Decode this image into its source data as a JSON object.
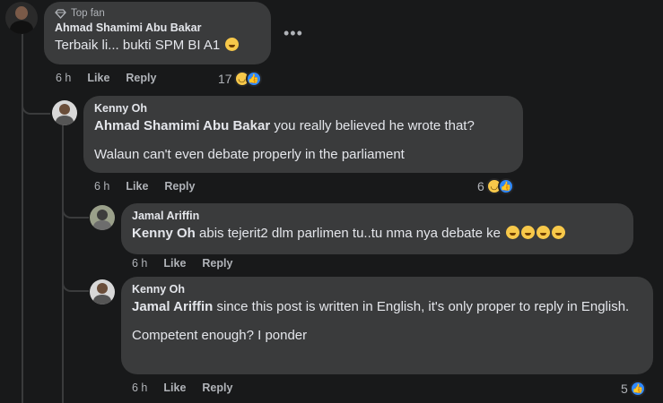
{
  "comments": [
    {
      "badge": "Top fan",
      "author": "Ahmad Shamimi Abu Bakar",
      "text": "Terbaik li... bukti SPM BI A1",
      "time": "6 h",
      "like": "Like",
      "reply": "Reply",
      "reactions": "17"
    },
    {
      "author": "Kenny Oh",
      "mention": "Ahmad Shamimi Abu Bakar",
      "text_after_mention": " you really believed he wrote that?",
      "text2": "Walaun can't even debate properly in the parliament",
      "time": "6 h",
      "like": "Like",
      "reply": "Reply",
      "reactions": "6"
    },
    {
      "author": "Jamal Ariffin",
      "mention": "Kenny Oh",
      "text_after_mention": " abis tejerit2 dlm parlimen tu..tu nma nya debate ke ",
      "time": "6 h",
      "like": "Like",
      "reply": "Reply"
    },
    {
      "author": "Kenny Oh",
      "mention": "Jamal Ariffin",
      "text_after_mention": " since this post is written in English, it's only proper to reply in English.",
      "text2": "Competent enough? I ponder",
      "time": "6 h",
      "like": "Like",
      "reply": "Reply",
      "reactions": "5"
    }
  ],
  "more_options": "•••",
  "colors": {
    "background": "#18191a",
    "bubble": "#3a3b3c",
    "text": "#e4e6eb",
    "secondary": "#b0b3b8",
    "like_blue": "#2d88ff",
    "haha_yellow": "#f7c84a"
  },
  "icons": [
    "top-fan-diamond-icon",
    "haha-reaction-icon",
    "like-reaction-icon",
    "more-options-icon"
  ]
}
